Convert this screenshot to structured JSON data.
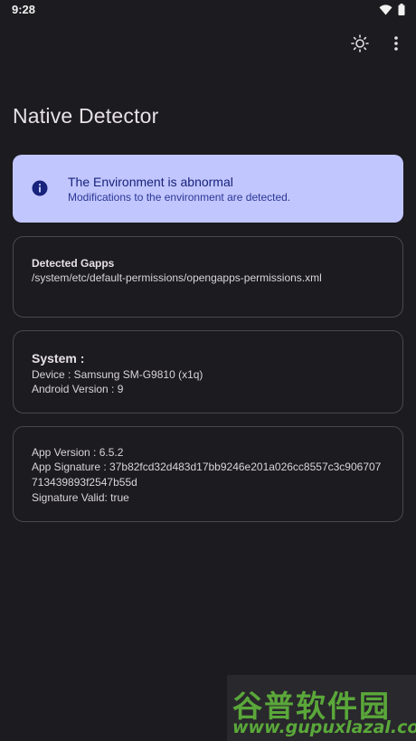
{
  "status_bar": {
    "time": "9:28",
    "icons": [
      "wifi-icon",
      "battery-icon"
    ]
  },
  "toolbar": {
    "icons": [
      "brightness-icon",
      "more-vert-icon"
    ]
  },
  "app": {
    "title": "Native Detector"
  },
  "alert": {
    "title": "The Environment is abnormal",
    "message": "Modifications to the environment are detected.",
    "icon": "info-icon",
    "bg_color": "#c2c6ff"
  },
  "gapps_card": {
    "heading": "Detected Gapps",
    "path": "/system/etc/default-permissions/opengapps-permissions.xml"
  },
  "system_card": {
    "heading": "System :",
    "device": "Device : Samsung SM-G9810  (x1q)",
    "android_version": "Android Version : 9"
  },
  "app_card": {
    "version": "App Version : 6.5.2",
    "signature_line1": "App Signature : 37b82fcd32d483d17bb9246e201a026cc8557c3c906707",
    "signature_line2": "713439893f2547b55d",
    "signature_valid": "Signature Valid: true"
  },
  "watermark": {
    "cn_text": "谷普软件园",
    "url": "www.gupuxlazal.com"
  }
}
